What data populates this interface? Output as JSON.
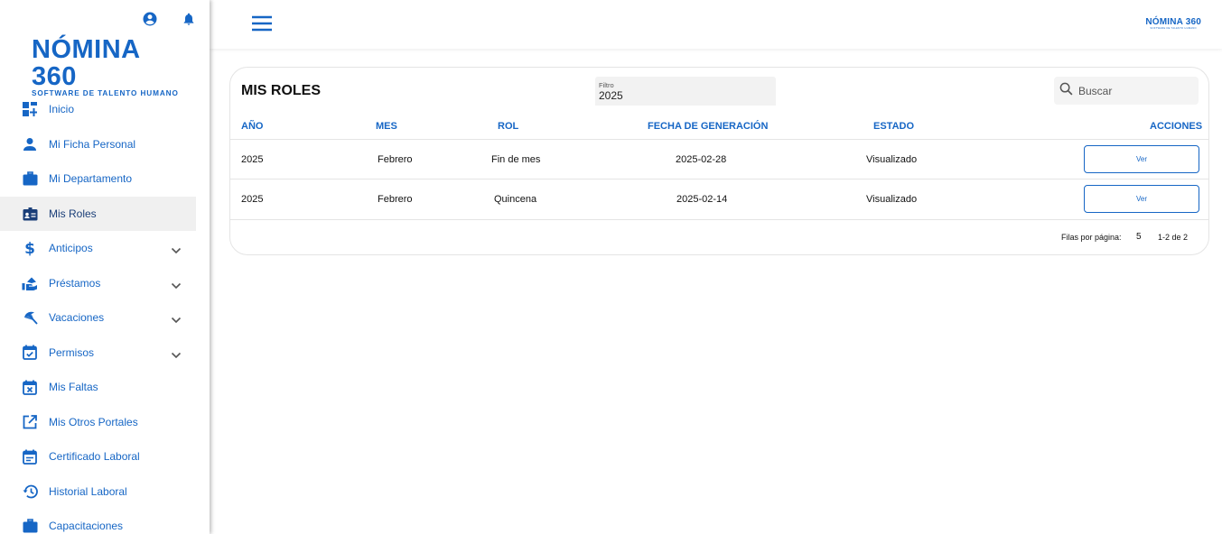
{
  "sidebar": {
    "logo": {
      "main": "NÓMINA 360",
      "sub": "SOFTWARE DE TALENTO HUMANO"
    },
    "top_icons": [
      "account-circle-icon",
      "bell-icon"
    ],
    "items": [
      {
        "label": "Inicio",
        "icon": "dashboard-icon",
        "expandable": false
      },
      {
        "label": "Mi Ficha Personal",
        "icon": "person-icon",
        "expandable": false
      },
      {
        "label": "Mi Departamento",
        "icon": "briefcase-icon",
        "expandable": false
      },
      {
        "label": "Mis Roles",
        "icon": "badge-icon",
        "expandable": false,
        "active": true
      },
      {
        "label": "Anticipos",
        "icon": "dollar-icon",
        "expandable": true
      },
      {
        "label": "Préstamos",
        "icon": "hand-money-icon",
        "expandable": true
      },
      {
        "label": "Vacaciones",
        "icon": "beach-umbrella-icon",
        "expandable": true
      },
      {
        "label": "Permisos",
        "icon": "calendar-check-icon",
        "expandable": true
      },
      {
        "label": "Mis Faltas",
        "icon": "calendar-x-icon",
        "expandable": false
      },
      {
        "label": "Mis Otros Portales",
        "icon": "open-in-new-icon",
        "expandable": false
      },
      {
        "label": "Certificado Laboral",
        "icon": "calendar-text-icon",
        "expandable": false
      },
      {
        "label": "Historial Laboral",
        "icon": "history-icon",
        "expandable": false
      },
      {
        "label": "Capacitaciones",
        "icon": "school-icon",
        "expandable": false
      }
    ]
  },
  "topbar": {
    "brand": {
      "main": "NÓMINA 360",
      "sub": "SOFTWARE DE TALENTO HUMANO"
    }
  },
  "card": {
    "title": "MIS ROLES",
    "filter": {
      "label": "Filtro",
      "value": "2025"
    },
    "search": {
      "placeholder": "Buscar"
    },
    "columns": [
      "AÑO",
      "MES",
      "ROL",
      "FECHA DE GENERACIÓN",
      "ESTADO",
      "ACCIONES"
    ],
    "rows": [
      {
        "anio": "2025",
        "mes": "Febrero",
        "rol": "Fin de mes",
        "fecha": "2025-02-28",
        "estado": "Visualizado",
        "accion": "Ver"
      },
      {
        "anio": "2025",
        "mes": "Febrero",
        "rol": "Quincena",
        "fecha": "2025-02-14",
        "estado": "Visualizado",
        "accion": "Ver"
      }
    ],
    "pagination": {
      "rows_per_page_label": "Filas por página:",
      "rows_per_page": "5",
      "range": "1-2 de 2"
    }
  },
  "colors": {
    "primary": "#1666c5",
    "active_bg": "#f0f0f0",
    "active_text": "#1a3e78"
  }
}
